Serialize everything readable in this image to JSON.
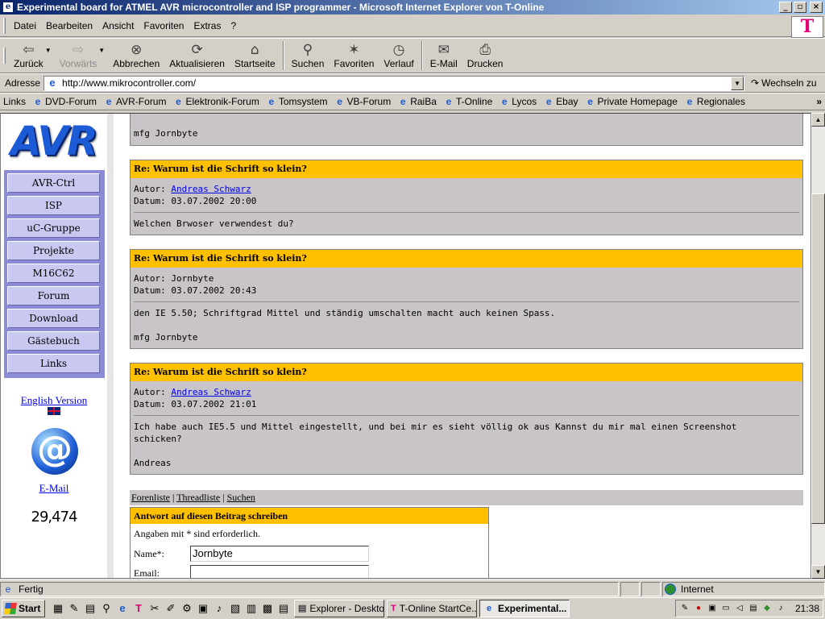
{
  "window": {
    "title": "Experimental board for ATMEL AVR microcontroller and ISP programmer - Microsoft Internet Explorer von T-Online",
    "minimize": "_",
    "restore": "▫",
    "close": "×"
  },
  "menu": {
    "items": [
      "Datei",
      "Bearbeiten",
      "Ansicht",
      "Favoriten",
      "Extras",
      "?"
    ]
  },
  "brand_logo": "T",
  "toolbar": {
    "buttons": [
      {
        "label": "Zurück",
        "icon": "back-arrow-icon",
        "glyph": "⇦"
      },
      {
        "label": "Vorwärts",
        "icon": "forward-arrow-icon",
        "glyph": "⇨"
      },
      {
        "label": "Abbrechen",
        "icon": "stop-icon",
        "glyph": "⊗"
      },
      {
        "label": "Aktualisieren",
        "icon": "refresh-icon",
        "glyph": "⟳"
      },
      {
        "label": "Startseite",
        "icon": "home-icon",
        "glyph": "⌂"
      },
      {
        "label": "Suchen",
        "icon": "search-icon",
        "glyph": "⚲"
      },
      {
        "label": "Favoriten",
        "icon": "favorites-icon",
        "glyph": "✶"
      },
      {
        "label": "Verlauf",
        "icon": "history-icon",
        "glyph": "◷"
      },
      {
        "label": "E-Mail",
        "icon": "mail-icon",
        "glyph": "✉"
      },
      {
        "label": "Drucken",
        "icon": "print-icon",
        "glyph": "⎙"
      }
    ]
  },
  "address": {
    "label": "Adresse",
    "url": "http://www.mikrocontroller.com/",
    "go_label": "Wechseln zu"
  },
  "links_bar": {
    "label": "Links",
    "items": [
      "DVD-Forum",
      "AVR-Forum",
      "Elektronik-Forum",
      "Tomsystem",
      "VB-Forum",
      "RaiBa",
      "T-Online",
      "Lycos",
      "Ebay",
      "Private Homepage",
      "Regionales"
    ],
    "more": "»"
  },
  "sidebar": {
    "logo_text": "AVR",
    "nav": [
      "AVR-Ctrl",
      "ISP",
      "uC-Gruppe",
      "Projekte",
      "M16C62",
      "Forum",
      "Download",
      "Gästebuch",
      "Links"
    ],
    "english_version": "English Version",
    "email_glyph": "@",
    "email_label": "E-Mail",
    "counter": "29,474"
  },
  "posts": [
    {
      "partial": true,
      "body": "mfg Jornbyte"
    },
    {
      "subject": "Re: Warum ist die Schrift so klein?",
      "author_label": "Autor:",
      "author": "Andreas Schwarz",
      "author_link": true,
      "date_label": "Datum:",
      "date": "03.07.2002 20:00",
      "body": "Welchen Brwoser verwendest du?"
    },
    {
      "subject": "Re: Warum ist die Schrift so klein?",
      "author_label": "Autor:",
      "author": "Jornbyte",
      "author_link": false,
      "date_label": "Datum:",
      "date": "03.07.2002 20:43",
      "body": "den IE 5.50; Schriftgrad Mittel und ständig umschalten macht auch keinen Spass.\n\nmfg Jornbyte"
    },
    {
      "subject": "Re: Warum ist die Schrift so klein?",
      "author_label": "Autor:",
      "author": "Andreas Schwarz",
      "author_link": true,
      "date_label": "Datum:",
      "date": "03.07.2002 21:01",
      "body": "Ich habe auch IE5.5 und Mittel eingestellt, und bei mir es sieht völlig ok aus Kannst du mir mal einen Screenshot\nschicken?\n\nAndreas"
    }
  ],
  "forum_nav": {
    "forenliste": "Forenliste",
    "threadliste": "Threadliste",
    "suchen": "Suchen",
    "sep": "|"
  },
  "reply_form": {
    "title": "Antwort auf diesen Beitrag schreiben",
    "required_note": "Angaben mit * sind erforderlich.",
    "name_label": "Name*:",
    "name_value": "Jornbyte",
    "email_label": "Email:",
    "email_value": ""
  },
  "statusbar": {
    "status": "Fertig",
    "zone": "Internet"
  },
  "taskbar": {
    "start": "Start",
    "tasks": [
      {
        "label": "Explorer - Desktop",
        "active": false
      },
      {
        "label": "T-Online StartCe...",
        "active": false
      },
      {
        "label": "Experimental...",
        "active": true
      }
    ],
    "clock": "21:38"
  },
  "colors": {
    "post_header": "#ffc000",
    "post_body": "#c8c4c8",
    "nav_box": "#8c8cd6",
    "link": "#0000ee"
  }
}
